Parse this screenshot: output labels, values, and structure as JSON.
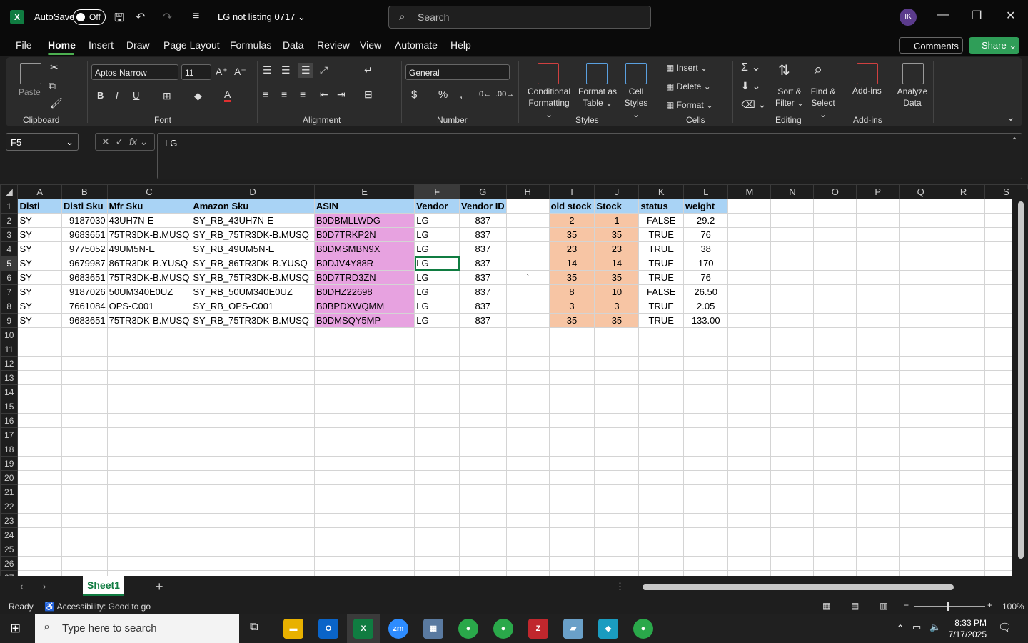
{
  "titlebar": {
    "autosave": "AutoSave",
    "toggle": "Off",
    "doc_title": "LG not listing 0717",
    "search_placeholder": "Search",
    "avatar": "IK"
  },
  "menu": {
    "items": [
      "File",
      "Home",
      "Insert",
      "Draw",
      "Page Layout",
      "Formulas",
      "Data",
      "Review",
      "View",
      "Automate",
      "Help"
    ],
    "comments": "Comments",
    "share": "Share"
  },
  "ribbon": {
    "clipboard": {
      "paste": "Paste",
      "label": "Clipboard"
    },
    "font": {
      "name": "Aptos Narrow",
      "size": "11",
      "label": "Font"
    },
    "alignment": {
      "label": "Alignment"
    },
    "number": {
      "format": "General",
      "label": "Number"
    },
    "styles": {
      "cond1": "Conditional",
      "cond2": "Formatting",
      "fmt1": "Format as",
      "fmt2": "Table",
      "cell1": "Cell",
      "cell2": "Styles",
      "label": "Styles"
    },
    "cells": {
      "insert": "Insert",
      "delete": "Delete",
      "format": "Format",
      "label": "Cells"
    },
    "editing": {
      "sort1": "Sort &",
      "sort2": "Filter",
      "find1": "Find &",
      "find2": "Select",
      "label": "Editing"
    },
    "addins": {
      "addins": "Add-ins",
      "analyze1": "Analyze",
      "analyze2": "Data",
      "label": "Add-ins"
    }
  },
  "formula": {
    "namebox": "F5",
    "value": "LG"
  },
  "sheet": {
    "columns": [
      "A",
      "B",
      "C",
      "D",
      "E",
      "F",
      "G",
      "H",
      "I",
      "J",
      "K",
      "L",
      "M",
      "N",
      "O",
      "P",
      "Q",
      "R",
      "S"
    ],
    "rows": [
      [
        "Disti",
        "Disti Sku",
        "Mfr Sku",
        "Amazon Sku",
        "ASIN",
        "Vendor",
        "Vendor ID",
        "",
        "old stock",
        "Stock",
        "status",
        "weight"
      ],
      [
        "SY",
        "9187030",
        "43UH7N-E",
        "SY_RB_43UH7N-E",
        "B0DBMLLWDG",
        "LG",
        "837",
        "",
        "2",
        "1",
        "FALSE",
        "29.2"
      ],
      [
        "SY",
        "9683651",
        "75TR3DK-B.MUSQ",
        "SY_RB_75TR3DK-B.MUSQ",
        "B0D7TRKP2N",
        "LG",
        "837",
        "",
        "35",
        "35",
        "TRUE",
        "76"
      ],
      [
        "SY",
        "9775052",
        "49UM5N-E",
        "SY_RB_49UM5N-E",
        "B0DMSMBN9X",
        "LG",
        "837",
        "",
        "23",
        "23",
        "TRUE",
        "38"
      ],
      [
        "SY",
        "9679987",
        "86TR3DK-B.YUSQ",
        "SY_RB_86TR3DK-B.YUSQ",
        "B0DJV4Y88R",
        "LG",
        "837",
        "",
        "14",
        "14",
        "TRUE",
        "170"
      ],
      [
        "SY",
        "9683651",
        "75TR3DK-B.MUSQ",
        "SY_RB_75TR3DK-B.MUSQ",
        "B0D7TRD3ZN",
        "LG",
        "837",
        "`",
        "35",
        "35",
        "TRUE",
        "76"
      ],
      [
        "SY",
        "9187026",
        "50UM340E0UZ",
        "SY_RB_50UM340E0UZ",
        "B0DHZ22698",
        "LG",
        "837",
        "",
        "8",
        "10",
        "FALSE",
        "26.50"
      ],
      [
        "SY",
        "7661084",
        "OPS-C001",
        "SY_RB_OPS-C001",
        "B0BPDXWQMM",
        "LG",
        "837",
        "",
        "3",
        "3",
        "TRUE",
        "2.05"
      ],
      [
        "SY",
        "9683651",
        "75TR3DK-B.MUSQ",
        "SY_RB_75TR3DK-B.MUSQ",
        "B0DMSQY5MP",
        "LG",
        "837",
        "",
        "35",
        "35",
        "TRUE",
        "133.00"
      ]
    ],
    "tab": "Sheet1"
  },
  "status": {
    "ready": "Ready",
    "accessibility": "Accessibility: Good to go",
    "zoom": "100%"
  },
  "taskbar": {
    "search": "Type here to search",
    "time": "8:33 PM",
    "date": "7/17/2025"
  },
  "colors": {
    "excel_green": "#107c41",
    "header_blue": "#a9d3f5",
    "asin_pink": "#e7a2e0",
    "stock_peach": "#f7c5a4"
  }
}
